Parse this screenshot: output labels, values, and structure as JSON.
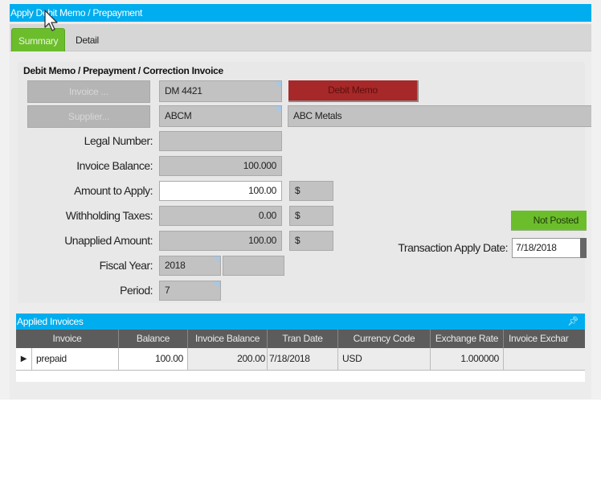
{
  "window": {
    "title": "Apply Debit Memo / Prepayment"
  },
  "tabs": [
    {
      "label": "Summary",
      "active": true
    },
    {
      "label": "Detail",
      "active": false
    }
  ],
  "group": {
    "title": "Debit Memo / Prepayment / Correction Invoice",
    "invoice_button": "Invoice ...",
    "supplier_button": "Supplier...",
    "invoice_value": "DM 4421",
    "type_button": "Debit Memo",
    "supplier_id": "ABCM",
    "supplier_name": "ABC Metals",
    "labels": {
      "legal_number": "Legal Number:",
      "invoice_balance": "Invoice Balance:",
      "amount_to_apply": "Amount to Apply:",
      "withholding_taxes": "Withholding Taxes:",
      "unapplied_amount": "Unapplied Amount:",
      "fiscal_year": "Fiscal Year:",
      "period": "Period:",
      "transaction_apply_date": "Transaction Apply Date:"
    },
    "values": {
      "legal_number": "",
      "invoice_balance": "100.000",
      "amount_to_apply": "100.00",
      "withholding_taxes": "0.00",
      "unapplied_amount": "100.00",
      "currency_symbol": "$",
      "fiscal_year": "2018",
      "fiscal_year_suffix": "",
      "period": "7",
      "transaction_apply_date": "7/18/2018"
    },
    "status": "Not Posted"
  },
  "applied_invoices": {
    "title": "Applied Invoices",
    "pin_icon": "pushpin-icon",
    "columns": [
      "Invoice",
      "Balance",
      "Invoice Balance",
      "Tran Date",
      "Currency Code",
      "Exchange Rate",
      "Invoice Exchar"
    ],
    "rows": [
      {
        "invoice": "prepaid",
        "balance": "100.00",
        "invoice_balance": "200.00",
        "tran_date": "7/18/2018",
        "currency_code": "USD",
        "exchange_rate": "1.000000",
        "invoice_exchange": ""
      }
    ]
  },
  "colors": {
    "title_blue": "#00adee",
    "active_tab_green": "#6cbd2c",
    "debit_memo_red": "#a72828",
    "status_green": "#6cbd2c"
  }
}
